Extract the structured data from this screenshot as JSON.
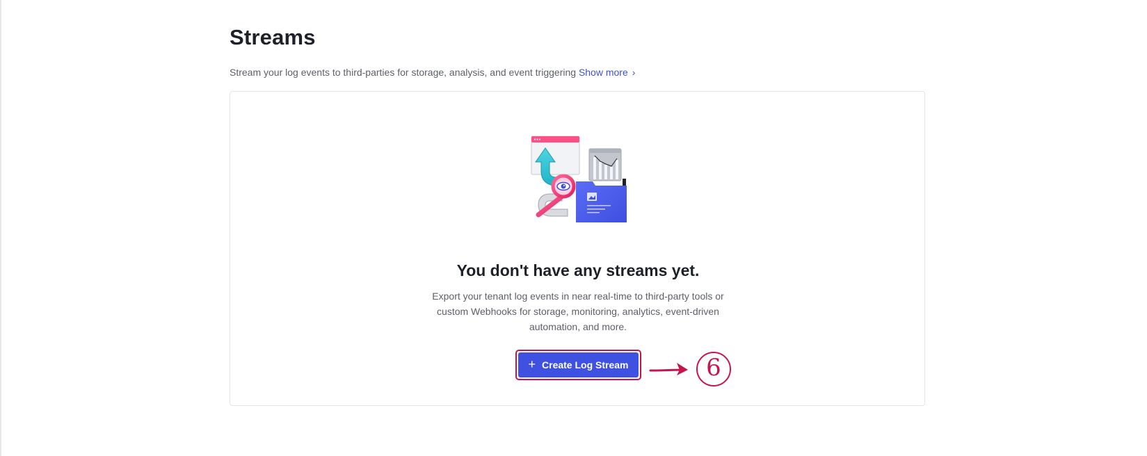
{
  "header": {
    "title": "Streams",
    "subtitle": "Stream your log events to third-parties for storage, analysis, and event triggering",
    "show_more_label": "Show more"
  },
  "empty_state": {
    "title": "You don't have any streams yet.",
    "description": "Export your tenant log events in near real-time to third-party tools or custom Webhooks for storage, monitoring, analytics, event-driven automation, and more.",
    "button_label": "Create Log Stream"
  },
  "annotation": {
    "step_number": "6"
  },
  "icons": {
    "chevron": "chevron-right-icon",
    "plus": "plus-icon",
    "illustration": "streams-illustration",
    "annotation_arrow": "arrow-right-icon"
  },
  "colors": {
    "accent": "#3f51e0",
    "link": "#3d52d5",
    "annotation": "#c8144c",
    "text_primary": "#1e212a",
    "text_secondary": "#5d6068"
  }
}
